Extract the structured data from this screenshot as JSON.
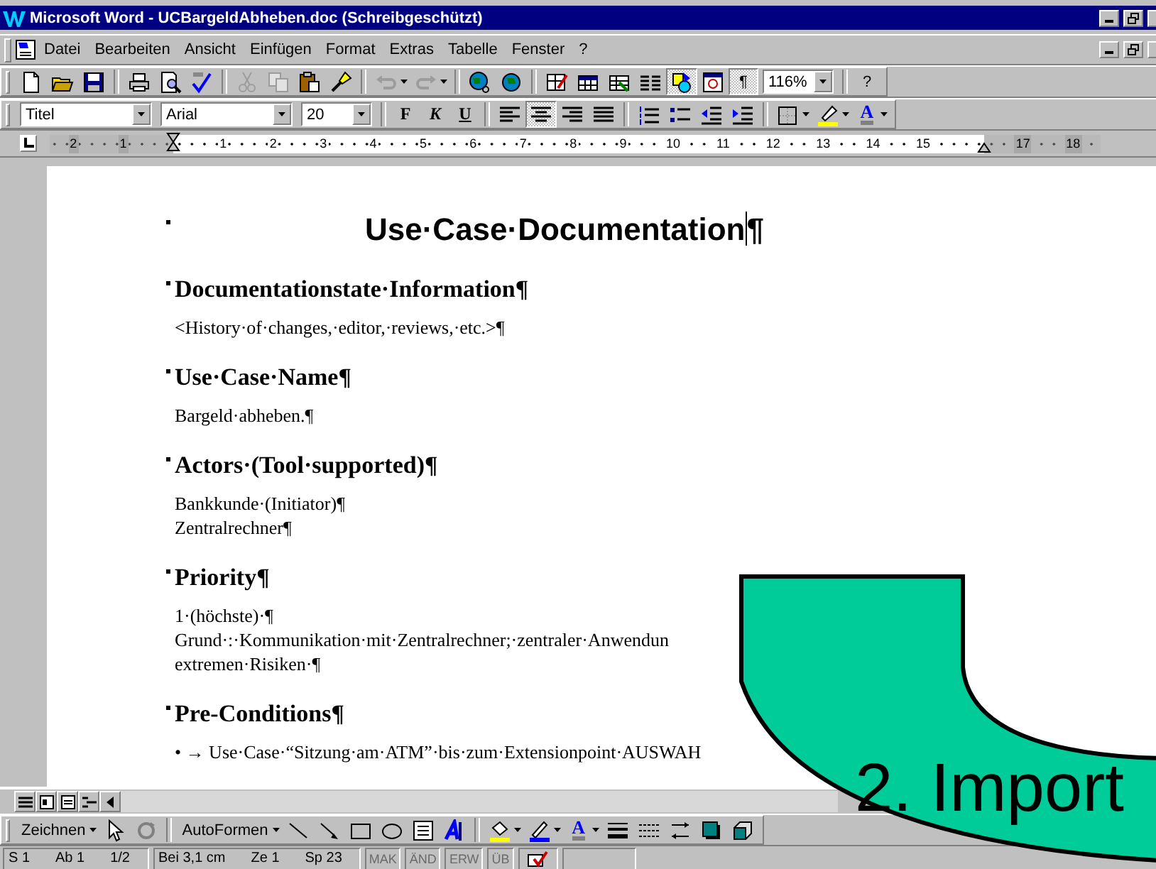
{
  "window": {
    "title": "Microsoft Word - UCBargeldAbheben.doc (Schreibgeschützt)"
  },
  "menu": [
    {
      "label": "Datei"
    },
    {
      "label": "Bearbeiten"
    },
    {
      "label": "Ansicht"
    },
    {
      "label": "Einfügen"
    },
    {
      "label": "Format"
    },
    {
      "label": "Extras"
    },
    {
      "label": "Tabelle"
    },
    {
      "label": "Fenster"
    },
    {
      "label": "?"
    }
  ],
  "standard_toolbar": [
    {
      "disabled": false,
      "pressed": false
    },
    {
      "disabled": false,
      "pressed": false
    },
    {
      "disabled": false,
      "pressed": false
    },
    {
      "disabled": false,
      "pressed": false
    },
    {
      "disabled": false,
      "pressed": false
    },
    {
      "disabled": false,
      "pressed": false
    },
    {
      "disabled": true,
      "pressed": false
    },
    {
      "disabled": true,
      "pressed": false
    },
    {
      "disabled": false,
      "pressed": false
    },
    {
      "disabled": false,
      "pressed": false
    },
    {
      "disabled": true,
      "pressed": false
    },
    {
      "disabled": true,
      "pressed": false
    },
    {
      "disabled": false,
      "pressed": false
    },
    {
      "disabled": false,
      "pressed": false
    },
    {
      "disabled": false,
      "pressed": false
    },
    {
      "disabled": false,
      "pressed": false
    },
    {
      "disabled": false,
      "pressed": false
    },
    {
      "disabled": false,
      "pressed": false
    },
    {
      "disabled": false,
      "pressed": true
    },
    {
      "disabled": false,
      "pressed": false
    },
    {
      "label": "¶",
      "disabled": false,
      "pressed": true
    },
    {
      "value": "116%"
    },
    {
      "label": "?",
      "disabled": false,
      "pressed": false
    }
  ],
  "format_toolbar": [
    {
      "value": "Titel"
    },
    {
      "value": "Arial"
    },
    {
      "value": "20"
    },
    {
      "label": "F",
      "pressed": false
    },
    {
      "label": "K",
      "pressed": false
    },
    {
      "label": "U",
      "pressed": false
    },
    {
      "pressed": false
    },
    {
      "pressed": true
    },
    {
      "pressed": false
    },
    {
      "pressed": false
    },
    {
      "pressed": false
    },
    {
      "pressed": false
    },
    {
      "pressed": false
    },
    {
      "pressed": false
    },
    {
      "label": "A",
      "pressed": false
    }
  ],
  "ruler": {
    "labels": [
      "2",
      "1",
      "1",
      "2",
      "3",
      "4",
      "5",
      "6",
      "7",
      "8",
      "9",
      "10",
      "11",
      "12",
      "13",
      "14",
      "15",
      "17",
      "18"
    ]
  },
  "document": {
    "title": "Use·Case·Documentation¶",
    "sections": [
      {
        "heading": "Documentationstate·Information¶",
        "lines": [
          "<History·of·changes,·editor,·reviews,·etc.>¶"
        ]
      },
      {
        "heading": "Use·Case·Name¶",
        "lines": [
          "Bargeld·abheben.¶"
        ]
      },
      {
        "heading": "Actors·(Tool·supported)¶",
        "lines": [
          "Bankkunde·(Initiator)¶",
          "Zentralrechner¶"
        ]
      },
      {
        "heading": "Priority¶",
        "lines": [
          "1·(höchste)·¶",
          "Grund·:·Kommunikation·mit·Zentralrechner;·zentraler·Anwendun",
          "extremen·Risiken·¶"
        ]
      },
      {
        "heading": "Pre-Conditions¶",
        "lines": [
          "•  →  Use·Case·“Sitzung·am·ATM”·bis·zum·Extensionpoint·AUSWAH"
        ]
      }
    ]
  },
  "drawing_toolbar": [
    {
      "label": "Zeichnen"
    },
    {
      "label": "AutoFormen"
    },
    {
      "label": "A"
    }
  ],
  "status_bar": [
    {
      "items": [
        {
          "label": "S 1"
        },
        {
          "label": "Ab 1"
        },
        {
          "label": "1/2"
        }
      ]
    },
    {
      "items": [
        {
          "label": "Bei 3,1 cm"
        },
        {
          "label": "Ze 1"
        },
        {
          "label": "Sp 23"
        }
      ]
    },
    {
      "indicators": [
        {
          "label": "MAK",
          "active": false
        },
        {
          "label": "ÄND",
          "active": false
        },
        {
          "label": "ERW",
          "active": false
        },
        {
          "label": "ÜB",
          "active": false
        }
      ]
    }
  ],
  "overlay": {
    "label": "2. Import"
  }
}
